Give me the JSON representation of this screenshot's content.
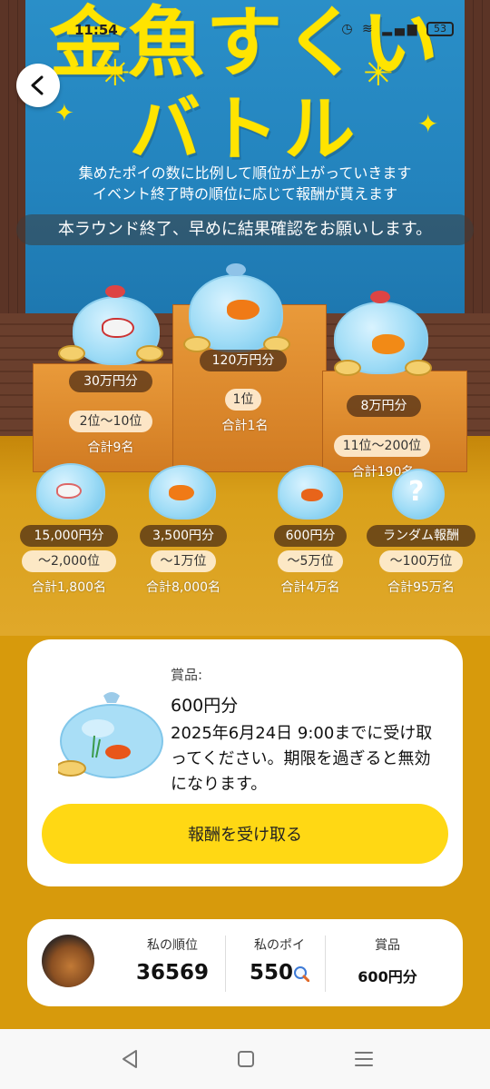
{
  "status_bar": {
    "time": "11:54",
    "battery": "53"
  },
  "hero": {
    "title_line1": "金魚すくい",
    "title_line2": "バトル",
    "subtitle_1": "集めたポイの数に比例して順位が上がっていきます",
    "subtitle_2": "イベント終了時の順位に応じて報酬が貰えます",
    "notice": "本ラウンド終了、早めに結果確認をお願いします。"
  },
  "tiers": [
    {
      "prize": "120万円分",
      "rank": "1位",
      "count": "合計1名"
    },
    {
      "prize": "30万円分",
      "rank": "2位〜10位",
      "count": "合計9名"
    },
    {
      "prize": "8万円分",
      "rank": "11位〜200位",
      "count": "合計190名"
    },
    {
      "prize": "15,000円分",
      "rank": "〜2,000位",
      "count": "合計1,800名"
    },
    {
      "prize": "3,500円分",
      "rank": "〜1万位",
      "count": "合計8,000名"
    },
    {
      "prize": "600円分",
      "rank": "〜5万位",
      "count": "合計4万名"
    },
    {
      "prize": "ランダム報酬",
      "rank": "〜100万位",
      "count": "合計95万名"
    }
  ],
  "prize_card": {
    "label": "賞品:",
    "value": "600円分",
    "description": "2025年6月24日 9:00までに受け取ってください。期限を過ぎると無効になります。",
    "button": "報酬を受け取る"
  },
  "user_stats": {
    "rank_label": "私の順位",
    "rank_value": "36569",
    "poi_label": "私のポイ",
    "poi_value": "550",
    "prize_label": "賞品",
    "prize_value": "600円分"
  },
  "colors": {
    "accent": "#ffd814",
    "background": "#d79a0c",
    "banner": "#2383bd",
    "title": "#ffe400"
  },
  "icons": [
    "back-chevron-icon",
    "poi-icon",
    "nav-back-icon",
    "nav-home-icon",
    "nav-menu-icon"
  ]
}
